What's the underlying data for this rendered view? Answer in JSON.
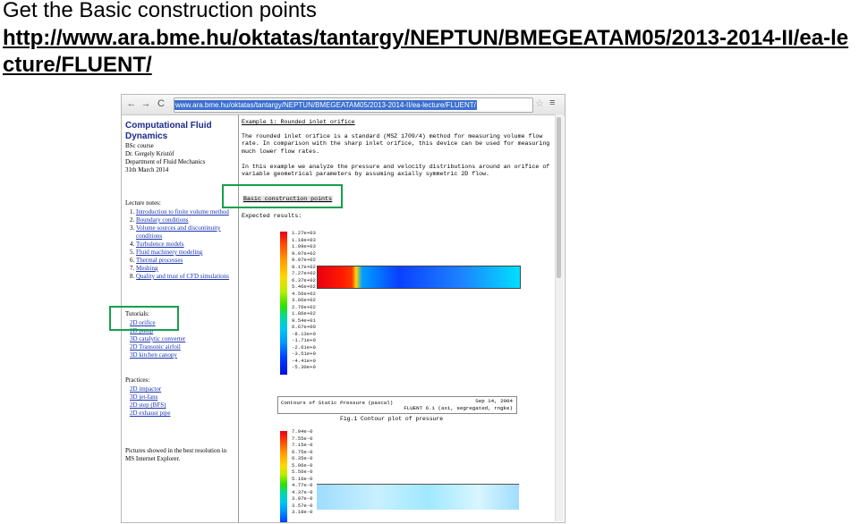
{
  "slide": {
    "title": "Get the Basic construction points",
    "link": "http://www.ara.bme.hu/oktatas/tantargy/NEPTUN/BMEGEATAM05/2013-2014-II/ea-lecture/FLUENT/"
  },
  "browser": {
    "url": "www.ara.bme.hu/oktatas/tantargy/NEPTUN/BMEGEATAM05/2013-2014-II/ea-lecture/FLUENT/"
  },
  "left": {
    "brand": "Computational Fluid Dynamics",
    "course": "BSc course",
    "author": "Dr. Gergely Kristóf",
    "dept": "Department of Fluid Mechanics",
    "date": "31th March 2014",
    "lecture_header": "Lecture notes:",
    "lectures": [
      "Introduction to finite volume method",
      "Boundary conditions",
      "Volume sources and discontinuity conditions",
      "Turbulence models",
      "Fluid machinery modeling",
      "Thermal processes",
      "Meshing",
      "Quality and trust of CFD simulations"
    ],
    "tutorial_header": "Tutorials:",
    "tutorials": [
      "2D orifice",
      "2D pump",
      "3D catalytic converter",
      "2D Transonic airfoil",
      "3D kitchen canopy"
    ],
    "practice_header": "Practices:",
    "practices": [
      "2D impactor",
      "3D jet-fans",
      "2D step (BFS)",
      "2D exhaust pipe"
    ],
    "note": "Pictures showed in the best resolution in MS Internet Explorer."
  },
  "right": {
    "example_title": "Example 1: Rounded inlet orifice",
    "p1": "The rounded inlet orifice is a standard (MSZ 1709/4) method for measuring volume flow rate. In comparison with the sharp inlet orifice, this device can be used for measuring much lower flow rates.",
    "p2": "In this example we analyze the pressure and velocity distributions around an orifice of variable geometrical parameters by assuming axially symmetric 2D flow.",
    "basic_link": "Basic construction points",
    "expected": "Expected results:",
    "ticks": [
      "1.27e+03",
      "1.18e+03",
      "1.09e+03",
      "9.97e+02",
      "9.07e+02",
      "8.17e+02",
      "7.27e+02",
      "6.37e+02",
      "5.46e+02",
      "4.56e+02",
      "3.66e+02",
      "2.76e+02",
      "1.86e+02",
      "9.54e+01",
      "6.67e+00",
      "-8.13e+0",
      "-1.71e+0",
      "-2.61e+0",
      "-3.51e+0",
      "-4.41e+0",
      "-5.30e+0"
    ],
    "plot_label": "Contours of Static Pressure (pascal)",
    "plot_date": "Sep 14, 2004",
    "plot_solver": "FLUENT 6.1 (axi, segregated, rngke)",
    "fig1": "Fig.1 Contour plot of pressure",
    "ticks2": [
      "7.94e-0",
      "7.55e-0",
      "7.15e-0",
      "6.75e-0",
      "6.35e-0",
      "5.96e-0",
      "5.56e-0",
      "5.16e-0",
      "4.77e-0",
      "4.37e-0",
      "3.97e-0",
      "3.57e-0",
      "3.18e-0"
    ]
  }
}
